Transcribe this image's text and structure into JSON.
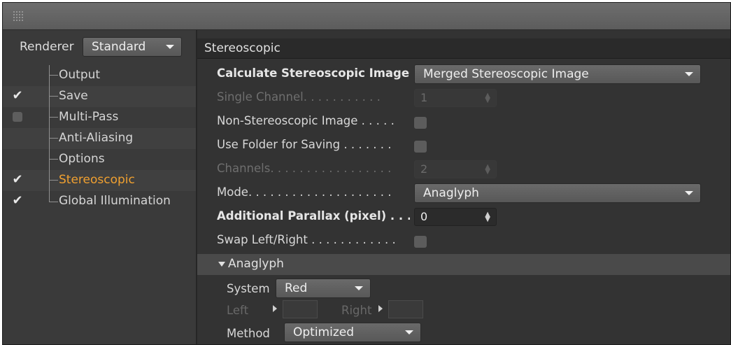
{
  "left_panel": {
    "renderer_label": "Renderer",
    "renderer_value": "Standard",
    "items": [
      {
        "label": "Output",
        "state": "none",
        "active": false
      },
      {
        "label": "Save",
        "state": "checked",
        "active": false
      },
      {
        "label": "Multi-Pass",
        "state": "unchecked",
        "active": false
      },
      {
        "label": "Anti-Aliasing",
        "state": "none",
        "active": false
      },
      {
        "label": "Options",
        "state": "none",
        "active": false
      },
      {
        "label": "Stereoscopic",
        "state": "checked",
        "active": true
      },
      {
        "label": "Global Illumination",
        "state": "checked",
        "active": false
      }
    ],
    "check_glyph": "✔"
  },
  "main": {
    "section_title": "Stereoscopic",
    "calc_label": "Calculate Stereoscopic Images",
    "calc_value": "Merged Stereoscopic Image",
    "single_channel_label": "Single Channel. . . . . . . . . . .",
    "single_channel_value": "1",
    "non_stereo_label": "Non-Stereoscopic Image . . . . .",
    "use_folder_label": "Use Folder for Saving . . . . . . .",
    "channels_label": "Channels. . . . . . . . . . . . . . . . .",
    "channels_value": "2",
    "mode_label": "Mode. . . . . . . . . . . . . . . . . . . .",
    "mode_value": "Anaglyph",
    "parallax_label": "Additional Parallax (pixel) . . .",
    "parallax_value": "0",
    "swap_label": "Swap Left/Right . . . . . . . . . . . .",
    "spin_glyph": "▲▼"
  },
  "anaglyph": {
    "title": "Anaglyph",
    "system_label": "System",
    "system_value": "Red",
    "left_label": "Left",
    "right_label": "Right",
    "method_label": "Method",
    "method_value": "Optimized"
  },
  "colors": {
    "active_item": "#f0a030",
    "panel_bg": "#333333",
    "header_bg": "#2a2a2a"
  }
}
